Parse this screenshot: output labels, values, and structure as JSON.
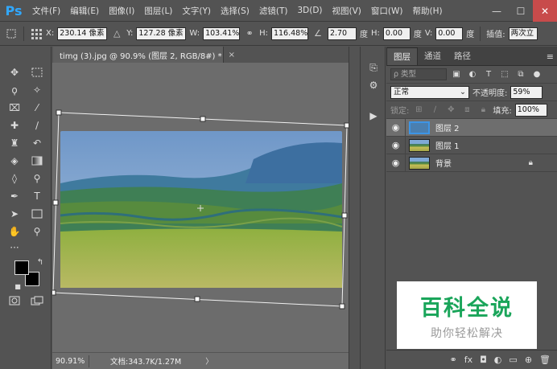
{
  "app": {
    "logo": "Ps"
  },
  "menu": [
    "文件(F)",
    "编辑(E)",
    "图像(I)",
    "图层(L)",
    "文字(Y)",
    "选择(S)",
    "滤镜(T)",
    "3D(D)",
    "视图(V)",
    "窗口(W)",
    "帮助(H)"
  ],
  "window_controls": {
    "minimize": "—",
    "maximize": "☐",
    "close": "✕"
  },
  "options": {
    "x_label": "X:",
    "x_value": "230.14 像素",
    "y_label": "Y:",
    "y_value": "127.28 像素",
    "w_label": "W:",
    "w_value": "103.41%",
    "h_label": "H:",
    "h_value": "116.48%",
    "angle_value": "2.70",
    "angle_unit": "度",
    "hskew_label": "H:",
    "hskew_value": "0.00",
    "hskew_unit": "度",
    "vskew_label": "V:",
    "vskew_value": "0.00",
    "vskew_unit": "度",
    "interp_label": "插值:",
    "interp_value": "两次立"
  },
  "document": {
    "tab_title": "timg (3).jpg @ 90.9% (图层 2, RGB/8#) *",
    "tab_close": "×",
    "zoom": "90.91%",
    "doc_info": "文档:343.7K/1.27M",
    "status_arrow": "〉"
  },
  "layers_panel": {
    "tabs": [
      "图层",
      "通道",
      "路径"
    ],
    "filter_placeholder": "ρ 类型",
    "blend_mode": "正常",
    "opacity_label": "不透明度:",
    "opacity_value": "59%",
    "lock_label": "锁定:",
    "fill_label": "填充:",
    "fill_value": "100%",
    "layers": [
      {
        "name": "图层 2",
        "selected": true,
        "visible": true,
        "locked": false,
        "thumb": "blue"
      },
      {
        "name": "图层 1",
        "selected": false,
        "visible": true,
        "locked": false,
        "thumb": "landscape"
      },
      {
        "name": "背景",
        "selected": false,
        "visible": true,
        "locked": true,
        "thumb": "landscape"
      }
    ]
  },
  "watermark": {
    "title": "百科全说",
    "subtitle": "助你轻松解决"
  },
  "colors": {
    "accent": "#31a8ff",
    "panel_bg": "#535353",
    "canvas_bg": "#6c6c6c",
    "watermark_green": "#1aa55a"
  }
}
